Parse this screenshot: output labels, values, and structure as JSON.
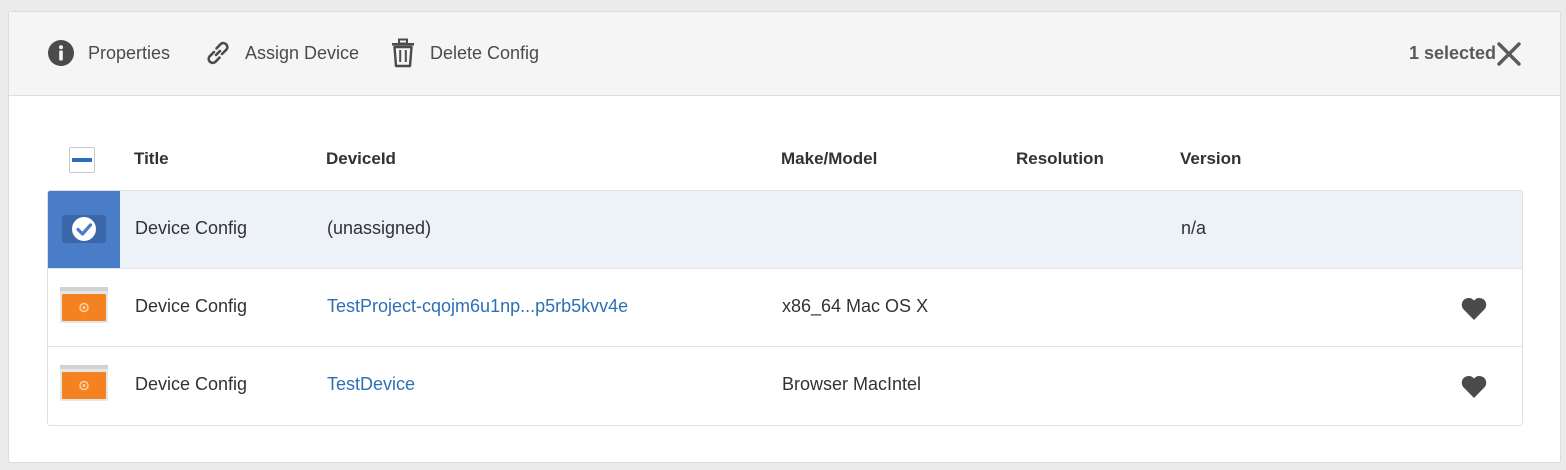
{
  "actions": {
    "properties": "Properties",
    "assign_device": "Assign Device",
    "delete_config": "Delete Config"
  },
  "selection": {
    "count_label": "1 selected"
  },
  "table": {
    "columns": [
      "Title",
      "DeviceId",
      "Make/Model",
      "Resolution",
      "Version"
    ],
    "rows": [
      {
        "title": "Device Config",
        "device_id": "(unassigned)",
        "make_model": "",
        "resolution": "",
        "version": "n/a",
        "selected": true,
        "favorite": false
      },
      {
        "title": "Device Config",
        "device_id": "TestProject-cqojm6u1np...p5rb5kvv4e",
        "make_model": "x86_64 Mac OS X",
        "resolution": "",
        "version": "",
        "selected": false,
        "favorite": true
      },
      {
        "title": "Device Config",
        "device_id": "TestDevice",
        "make_model": "Browser MacIntel",
        "resolution": "",
        "version": "",
        "selected": false,
        "favorite": true
      }
    ]
  },
  "colors": {
    "accent": "#2f6fbf",
    "selected_row": "#edf1f8",
    "thumbnail_orange": "#f58220",
    "link": "#2e6fb8"
  },
  "icons": {
    "properties": "info-icon",
    "assign_device": "link-icon",
    "delete_config": "trash-icon",
    "close": "close-icon",
    "favorite": "heart-icon",
    "selected": "checkmark-icon",
    "thumbnail": "device-thumbnail-icon"
  }
}
